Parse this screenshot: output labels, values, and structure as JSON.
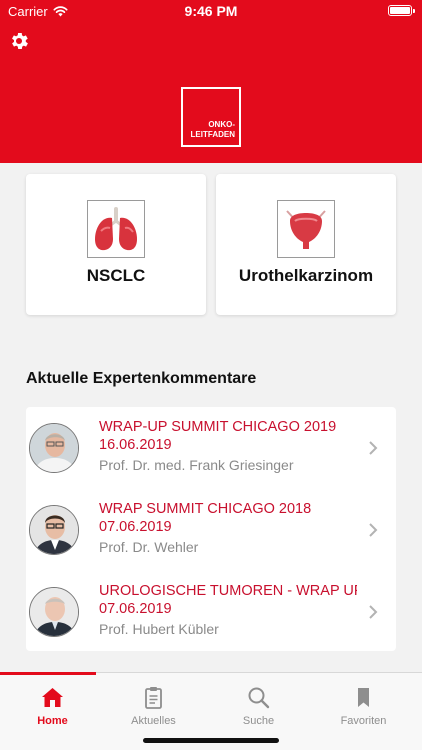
{
  "status_bar": {
    "carrier": "Carrier",
    "time": "9:46 PM"
  },
  "header": {
    "logo_line1": "ONKO-",
    "logo_line2": "LEITFADEN",
    "icons": {
      "settings": "gear-icon"
    },
    "colors": {
      "brand": "#e30b1c"
    }
  },
  "categories": [
    {
      "label": "NSCLC",
      "icon": "lungs-icon"
    },
    {
      "label": "Urothelkarzinom",
      "icon": "bladder-icon"
    }
  ],
  "section": {
    "title": "Aktuelle Expertenkommentare"
  },
  "comments": [
    {
      "title": "WRAP-UP SUMMIT CHICAGO 2019",
      "date": "16.06.2019",
      "author": "Prof. Dr. med. Frank Griesinger"
    },
    {
      "title": "WRAP SUMMIT CHICAGO 2018",
      "date": "07.06.2019",
      "author": "Prof. Dr. Wehler"
    },
    {
      "title": "UROLOGISCHE TUMOREN - WRAP UP SUMMIT",
      "date": "07.06.2019",
      "author": "Prof. Hubert Kübler"
    }
  ],
  "tabbar": {
    "tabs": [
      {
        "label": "Home",
        "icon": "home-icon",
        "active": true
      },
      {
        "label": "Aktuelles",
        "icon": "clipboard-icon",
        "active": false
      },
      {
        "label": "Suche",
        "icon": "search-icon",
        "active": false
      },
      {
        "label": "Favoriten",
        "icon": "bookmark-icon",
        "active": false
      }
    ]
  }
}
